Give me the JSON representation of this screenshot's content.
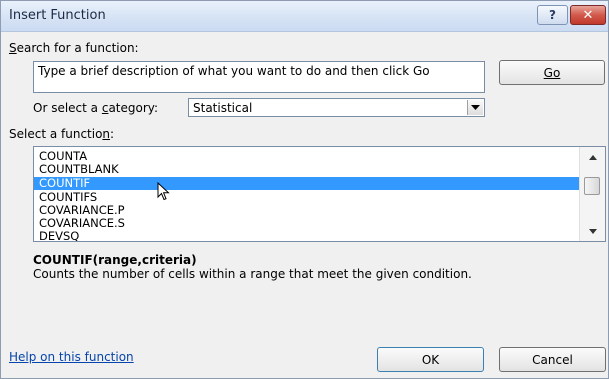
{
  "window": {
    "title": "Insert Function",
    "help_label": "?",
    "close_label": "✕"
  },
  "search": {
    "label": "Search for a function:",
    "label_prefix": "",
    "label_key": "S",
    "label_rest": "earch for a function:",
    "value": "Type a brief description of what you want to do and then click Go",
    "go_label": "Go"
  },
  "category": {
    "label_pre": "Or select a ",
    "label_key": "c",
    "label_post": "ategory:",
    "selected": "Statistical"
  },
  "functions": {
    "label_pre": "Select a functio",
    "label_key": "n",
    "label_post": ":",
    "items": [
      "COUNTA",
      "COUNTBLANK",
      "COUNTIF",
      "COUNTIFS",
      "COVARIANCE.P",
      "COVARIANCE.S",
      "DEVSQ"
    ],
    "selected": "COUNTIF"
  },
  "details": {
    "syntax": "COUNTIF(range,criteria)",
    "description": "Counts the number of cells within a range that meet the given condition."
  },
  "footer": {
    "help_link": "Help on this function",
    "ok_label": "OK",
    "cancel_label": "Cancel"
  },
  "icons": {
    "help": "question-mark-icon",
    "close": "close-icon",
    "dropdown": "chevron-down-icon",
    "scroll_up": "scroll-up-arrow-icon",
    "scroll_down": "scroll-down-arrow-icon",
    "cursor": "mouse-pointer-icon"
  },
  "colors": {
    "selection": "#3399ff",
    "link": "#0645ad",
    "close_button": "#c0392b"
  }
}
